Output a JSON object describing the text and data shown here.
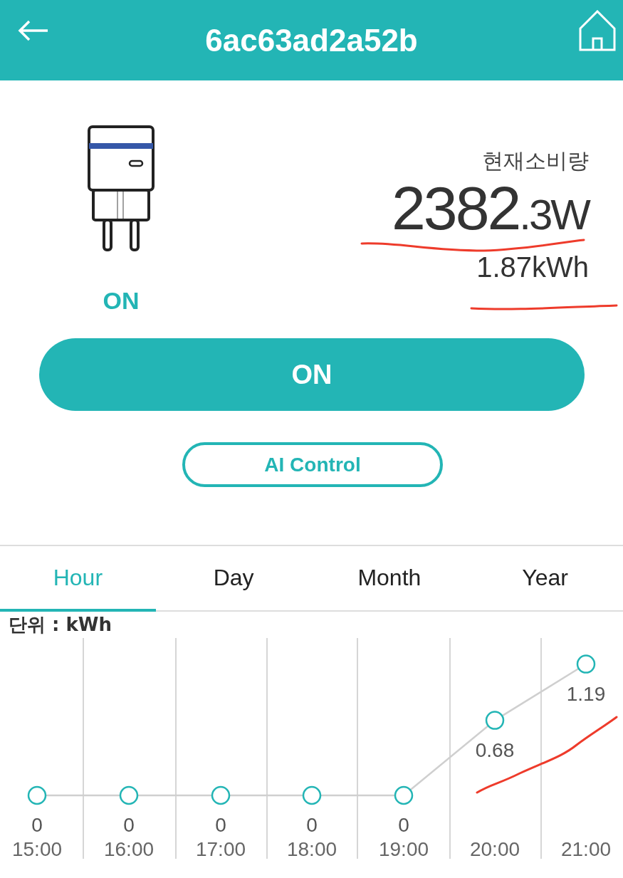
{
  "header": {
    "title": "6ac63ad2a52b"
  },
  "device": {
    "on": true,
    "status": "ON",
    "consumption_label": "현재소비량",
    "power_integer": "2382",
    "power_decimal": ".3W",
    "energy": "1.87kWh"
  },
  "power_button": {
    "label": "ON"
  },
  "ai_button": {
    "label": "AI Control"
  },
  "tabs": [
    {
      "label": "Hour",
      "selected": true
    },
    {
      "label": "Day",
      "selected": false
    },
    {
      "label": "Month",
      "selected": false
    },
    {
      "label": "Year",
      "selected": false
    }
  ],
  "chart": {
    "unit_label": "단위 : kWh",
    "chart_data": {
      "type": "line",
      "categories": [
        "15:00",
        "16:00",
        "17:00",
        "18:00",
        "19:00",
        "20:00",
        "21:00"
      ],
      "series": [
        {
          "color": "#cfcfcf",
          "marker": "circle",
          "values": [
            0,
            0,
            0,
            0,
            0,
            0.68,
            1.19
          ]
        }
      ],
      "data_labels": true
    }
  }
}
